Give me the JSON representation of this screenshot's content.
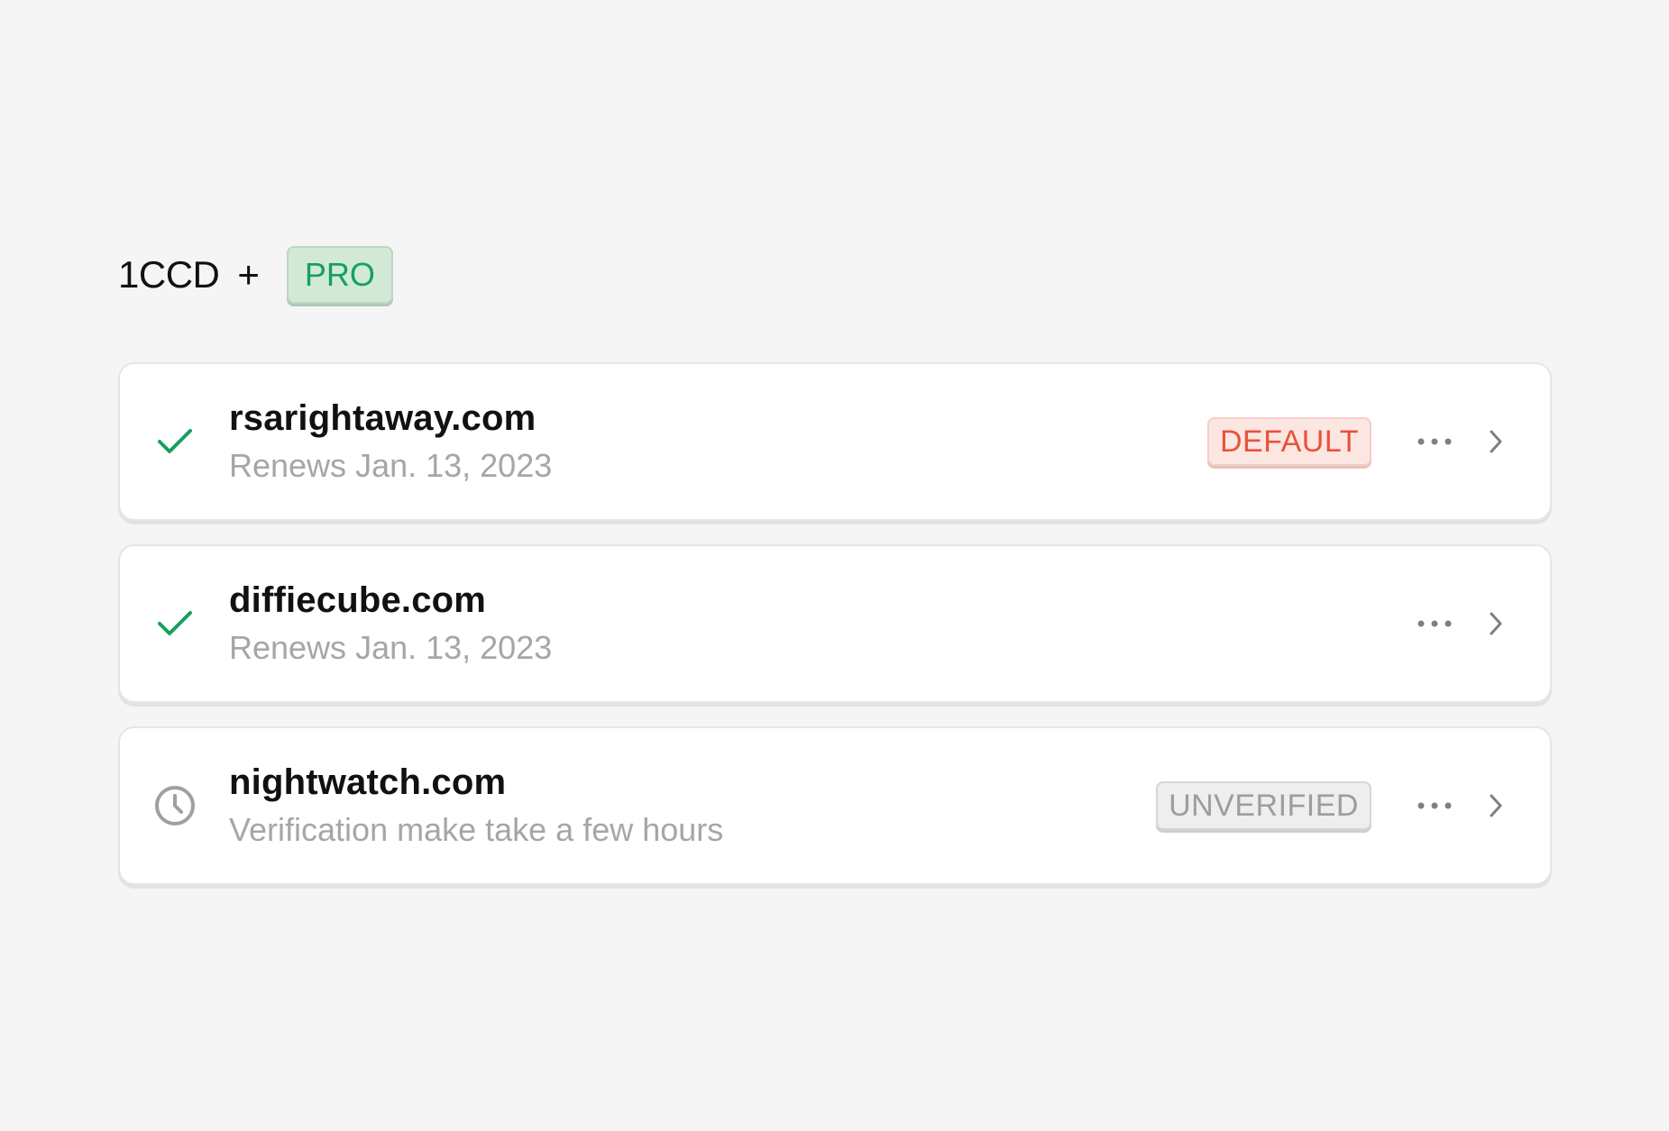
{
  "plan": {
    "name": "1CCD",
    "plus": "+",
    "badge": "PRO"
  },
  "colors": {
    "success": "#16a05d",
    "default_badge": "#e8533a",
    "muted": "#a6a6a6"
  },
  "domains": [
    {
      "name": "rsarightaway.com",
      "subtitle": "Renews Jan. 13, 2023",
      "status_icon": "check-icon",
      "badge": "DEFAULT"
    },
    {
      "name": "diffiecube.com",
      "subtitle": "Renews Jan. 13, 2023",
      "status_icon": "check-icon",
      "badge": ""
    },
    {
      "name": "nightwatch.com",
      "subtitle": "Verification make take a few hours",
      "status_icon": "clock-icon",
      "badge": "UNVERIFIED"
    }
  ]
}
